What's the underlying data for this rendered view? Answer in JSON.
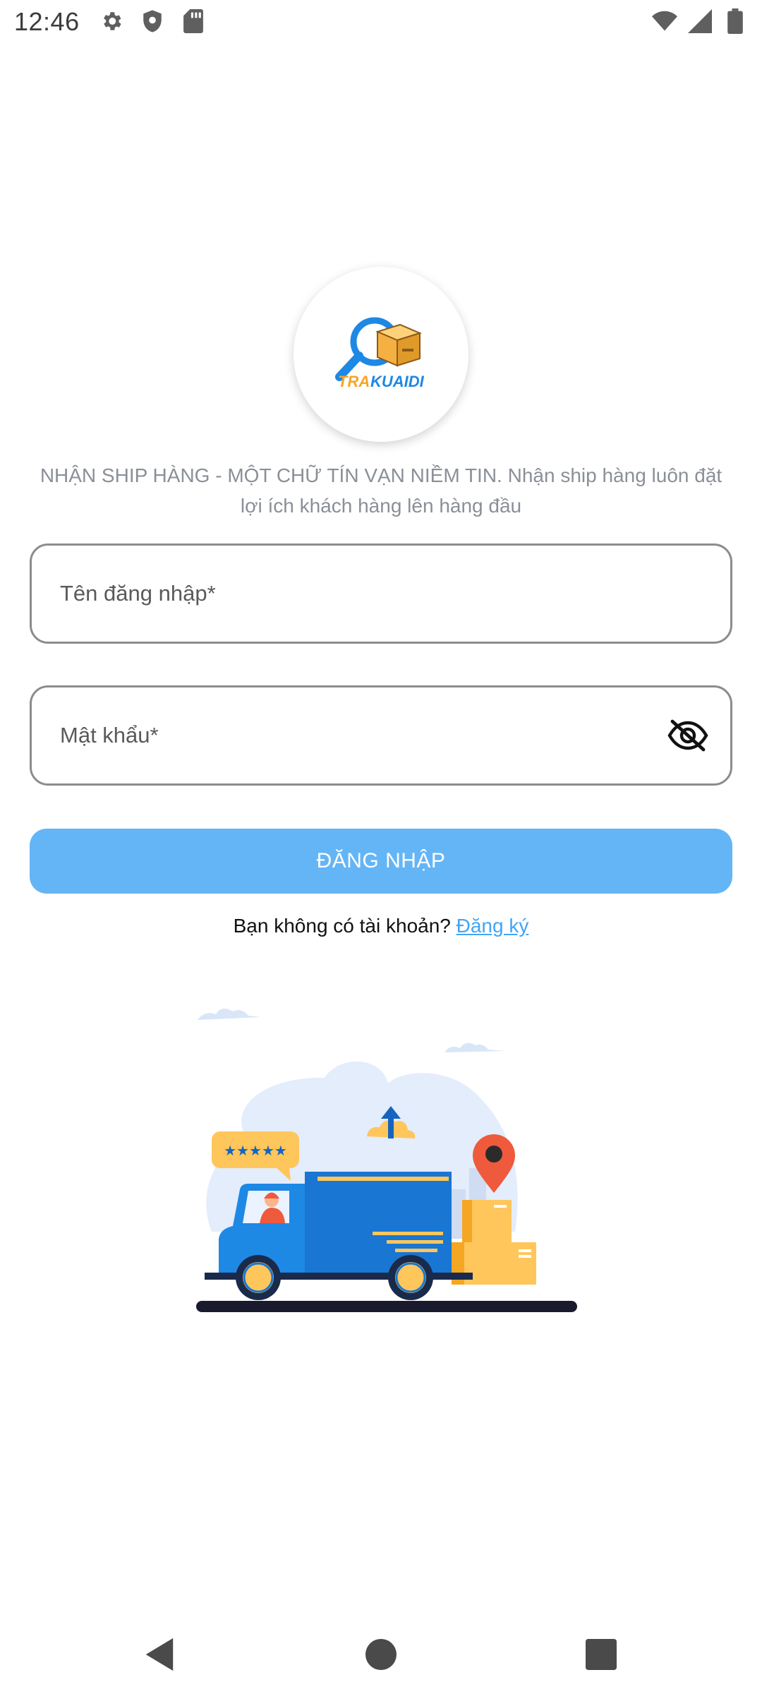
{
  "status_bar": {
    "time": "12:46",
    "left_icons": [
      "settings-icon",
      "shield-icon",
      "sd-card-icon"
    ],
    "right_icons": [
      "wifi-icon",
      "cellular-signal-icon",
      "battery-icon"
    ]
  },
  "logo": {
    "text": "TRAKUAIDI",
    "colors": {
      "blue": "#1e88e5",
      "orange": "#f5a623"
    }
  },
  "tagline": "NHẬN SHIP HÀNG - MỘT CHỮ TÍN VẠN NIỀM TIN. Nhận ship hàng luôn đặt lợi ích khách hàng lên hàng đầu",
  "form": {
    "username_placeholder": "Tên đăng nhập*",
    "password_placeholder": "Mật khẩu*",
    "toggle_password_icon": "eye-off-icon",
    "login_label": "ĐĂNG NHẬP"
  },
  "signup": {
    "prompt": "Bạn không có tài khoản? ",
    "link_label": "Đăng ký"
  },
  "illustration": {
    "rating_stars": "★★★★★",
    "subject": "delivery-truck-illustration"
  },
  "colors": {
    "primary_button": "#64b5f6",
    "link": "#42a5f5",
    "tagline": "#8a8f98",
    "truck_blue": "#1976d2",
    "box_orange": "#ffc65c",
    "pin_red": "#ef5a3c"
  },
  "nav_bar": {
    "buttons": [
      "back-icon",
      "home-icon",
      "recents-icon"
    ]
  }
}
